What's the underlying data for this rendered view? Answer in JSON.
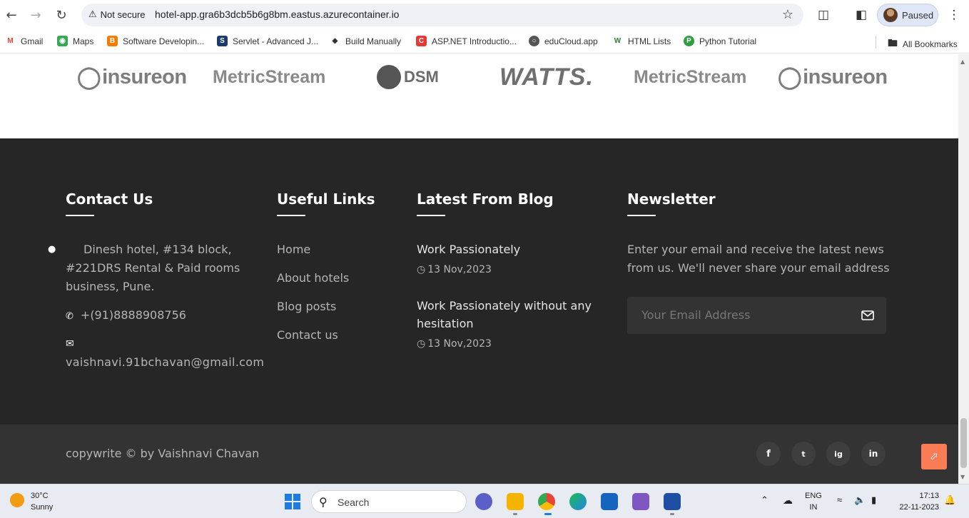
{
  "browser": {
    "security_label": "Not secure",
    "url": "hotel-app.gra6b3dcb5b6g8bm.eastus.azurecontainer.io",
    "profile_status": "Paused",
    "bookmarks": [
      {
        "label": "Gmail",
        "icon": "gmail-icon",
        "color": "#ea4335"
      },
      {
        "label": "Maps",
        "icon": "maps-icon",
        "color": "#34a853"
      },
      {
        "label": "Software Developin...",
        "icon": "blogger-icon",
        "color": "#f57c00"
      },
      {
        "label": "Servlet - Advanced J...",
        "icon": "servlet-icon",
        "color": "#1b3b6f"
      },
      {
        "label": "Build Manually",
        "icon": "build-icon",
        "color": "#333333"
      },
      {
        "label": "ASP.NET Introductio...",
        "icon": "aspnet-icon",
        "color": "#e53935"
      },
      {
        "label": "eduCloud.app",
        "icon": "globe-icon",
        "color": "#555555"
      },
      {
        "label": "HTML Lists",
        "icon": "w3-icon",
        "color": "#2e7d32"
      },
      {
        "label": "Python Tutorial",
        "icon": "python-icon",
        "color": "#2e9e3e"
      }
    ],
    "all_bookmarks": "All Bookmarks"
  },
  "logos": [
    "insureon",
    "MetricStream",
    "DSM",
    "WATTS.",
    "MetricStream",
    "insureon"
  ],
  "footer": {
    "contact": {
      "title": "Contact Us",
      "address": "Dinesh hotel, #134 block, #221DRS Rental & Paid rooms business, Pune.",
      "phone": "+(91)8888908756",
      "email": "vaishnavi.91bchavan@gmail.com"
    },
    "links": {
      "title": "Useful Links",
      "items": [
        "Home",
        "About hotels",
        "Blog posts",
        "Contact us"
      ]
    },
    "blog": {
      "title": "Latest From Blog",
      "posts": [
        {
          "title": "Work Passionately",
          "date": "13 Nov,2023"
        },
        {
          "title": "Work Passionately without any hesitation",
          "date": "13 Nov,2023"
        }
      ]
    },
    "newsletter": {
      "title": "Newsletter",
      "text": "Enter your email and receive the latest news from us. We'll never share your email address",
      "placeholder": "Your Email Address"
    }
  },
  "bottom": {
    "copyright": "copywrite © by Vaishnavi Chavan",
    "social": [
      "f",
      "t",
      "ig",
      "in"
    ]
  },
  "taskbar": {
    "temp": "30°C",
    "weather": "Sunny",
    "search": "Search",
    "lang1": "ENG",
    "lang2": "IN",
    "time": "17:13",
    "date": "22-11-2023"
  },
  "colors": {
    "footer_bg": "#262626",
    "bottom_bg": "#333333",
    "accent": "#f97c57"
  }
}
